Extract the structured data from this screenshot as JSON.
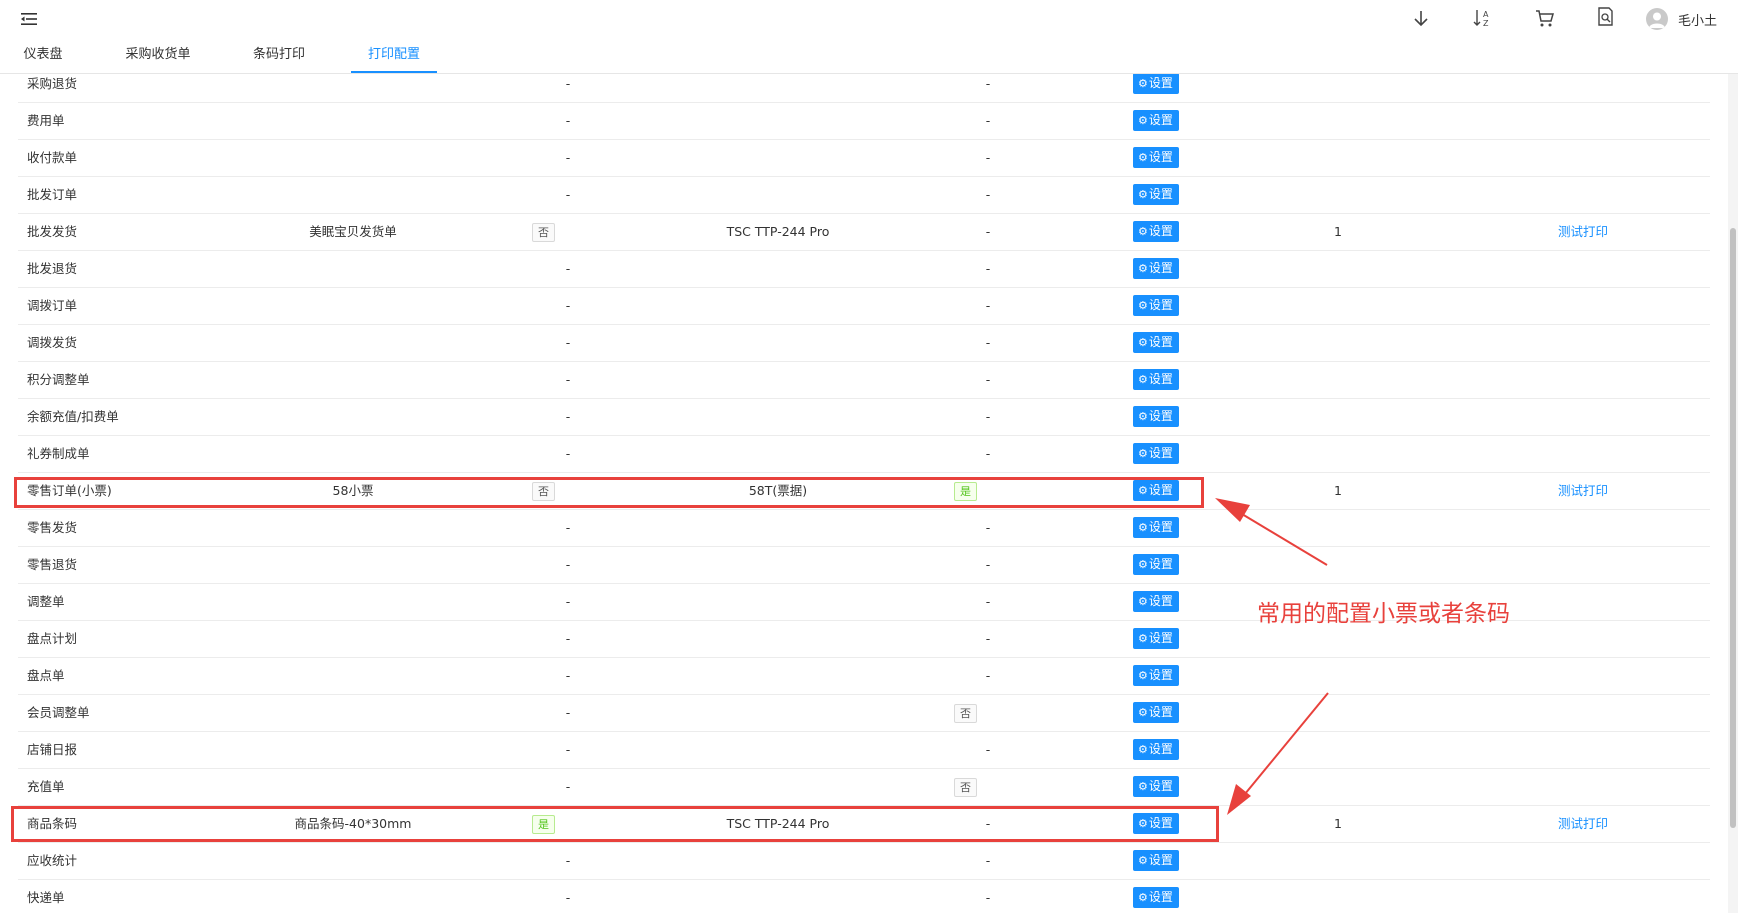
{
  "header": {
    "user_name": "毛小土",
    "icons": [
      "menu-fold-icon",
      "download-icon",
      "sort-az-icon",
      "cart-icon",
      "document-search-icon",
      "user-avatar-icon"
    ]
  },
  "tabs": [
    {
      "label": "仪表盘",
      "active": false
    },
    {
      "label": "采购收货单",
      "active": false
    },
    {
      "label": "条码打印",
      "active": false
    },
    {
      "label": "打印配置",
      "active": true
    }
  ],
  "settings_label": "设置",
  "rows": [
    {
      "name": "采购退货",
      "template": "",
      "preview_tag": "",
      "preview_dash": "-",
      "printer": "",
      "default_tag": "",
      "default_dash": "-",
      "count": "",
      "test": ""
    },
    {
      "name": "费用单",
      "template": "",
      "preview_tag": "",
      "preview_dash": "-",
      "printer": "",
      "default_tag": "",
      "default_dash": "-",
      "count": "",
      "test": ""
    },
    {
      "name": "收付款单",
      "template": "",
      "preview_tag": "",
      "preview_dash": "-",
      "printer": "",
      "default_tag": "",
      "default_dash": "-",
      "count": "",
      "test": ""
    },
    {
      "name": "批发订单",
      "template": "",
      "preview_tag": "",
      "preview_dash": "-",
      "printer": "",
      "default_tag": "",
      "default_dash": "-",
      "count": "",
      "test": ""
    },
    {
      "name": "批发发货",
      "template": "美眠宝贝发货单",
      "preview_tag": "否",
      "preview_dash": "",
      "printer": "TSC TTP-244 Pro",
      "default_tag": "",
      "default_dash": "-",
      "count": "1",
      "test": "测试打印"
    },
    {
      "name": "批发退货",
      "template": "",
      "preview_tag": "",
      "preview_dash": "-",
      "printer": "",
      "default_tag": "",
      "default_dash": "-",
      "count": "",
      "test": ""
    },
    {
      "name": "调拨订单",
      "template": "",
      "preview_tag": "",
      "preview_dash": "-",
      "printer": "",
      "default_tag": "",
      "default_dash": "-",
      "count": "",
      "test": ""
    },
    {
      "name": "调拨发货",
      "template": "",
      "preview_tag": "",
      "preview_dash": "-",
      "printer": "",
      "default_tag": "",
      "default_dash": "-",
      "count": "",
      "test": ""
    },
    {
      "name": "积分调整单",
      "template": "",
      "preview_tag": "",
      "preview_dash": "-",
      "printer": "",
      "default_tag": "",
      "default_dash": "-",
      "count": "",
      "test": ""
    },
    {
      "name": "余额充值/扣费单",
      "template": "",
      "preview_tag": "",
      "preview_dash": "-",
      "printer": "",
      "default_tag": "",
      "default_dash": "-",
      "count": "",
      "test": ""
    },
    {
      "name": "礼券制成单",
      "template": "",
      "preview_tag": "",
      "preview_dash": "-",
      "printer": "",
      "default_tag": "",
      "default_dash": "-",
      "count": "",
      "test": ""
    },
    {
      "name": "零售订单(小票)",
      "template": "58小票",
      "preview_tag": "否",
      "preview_dash": "",
      "printer": "58T(票据)",
      "default_tag": "是",
      "default_dash": "",
      "count": "1",
      "test": "测试打印"
    },
    {
      "name": "零售发货",
      "template": "",
      "preview_tag": "",
      "preview_dash": "-",
      "printer": "",
      "default_tag": "",
      "default_dash": "-",
      "count": "",
      "test": ""
    },
    {
      "name": "零售退货",
      "template": "",
      "preview_tag": "",
      "preview_dash": "-",
      "printer": "",
      "default_tag": "",
      "default_dash": "-",
      "count": "",
      "test": ""
    },
    {
      "name": "调整单",
      "template": "",
      "preview_tag": "",
      "preview_dash": "-",
      "printer": "",
      "default_tag": "",
      "default_dash": "-",
      "count": "",
      "test": ""
    },
    {
      "name": "盘点计划",
      "template": "",
      "preview_tag": "",
      "preview_dash": "-",
      "printer": "",
      "default_tag": "",
      "default_dash": "-",
      "count": "",
      "test": ""
    },
    {
      "name": "盘点单",
      "template": "",
      "preview_tag": "",
      "preview_dash": "-",
      "printer": "",
      "default_tag": "",
      "default_dash": "-",
      "count": "",
      "test": ""
    },
    {
      "name": "会员调整单",
      "template": "",
      "preview_tag": "",
      "preview_dash": "-",
      "printer": "",
      "default_tag": "否",
      "default_dash": "",
      "count": "",
      "test": ""
    },
    {
      "name": "店铺日报",
      "template": "",
      "preview_tag": "",
      "preview_dash": "-",
      "printer": "",
      "default_tag": "",
      "default_dash": "-",
      "count": "",
      "test": ""
    },
    {
      "name": "充值单",
      "template": "",
      "preview_tag": "",
      "preview_dash": "-",
      "printer": "",
      "default_tag": "否",
      "default_dash": "",
      "count": "",
      "test": ""
    },
    {
      "name": "商品条码",
      "template": "商品条码-40*30mm",
      "preview_tag": "是",
      "preview_dash": "",
      "printer": "TSC TTP-244 Pro",
      "default_tag": "",
      "default_dash": "-",
      "count": "1",
      "test": "测试打印"
    },
    {
      "name": "应收统计",
      "template": "",
      "preview_tag": "",
      "preview_dash": "-",
      "printer": "",
      "default_tag": "",
      "default_dash": "-",
      "count": "",
      "test": ""
    },
    {
      "name": "快递单",
      "template": "",
      "preview_tag": "",
      "preview_dash": "-",
      "printer": "",
      "default_tag": "",
      "default_dash": "-",
      "count": "",
      "test": ""
    }
  ],
  "annotation": {
    "text": "常用的配置小票或者条码",
    "color": "#e8413c"
  },
  "colors": {
    "accent": "#1890ff",
    "highlight": "#e8413c",
    "yes_tag": "#52c41a"
  }
}
